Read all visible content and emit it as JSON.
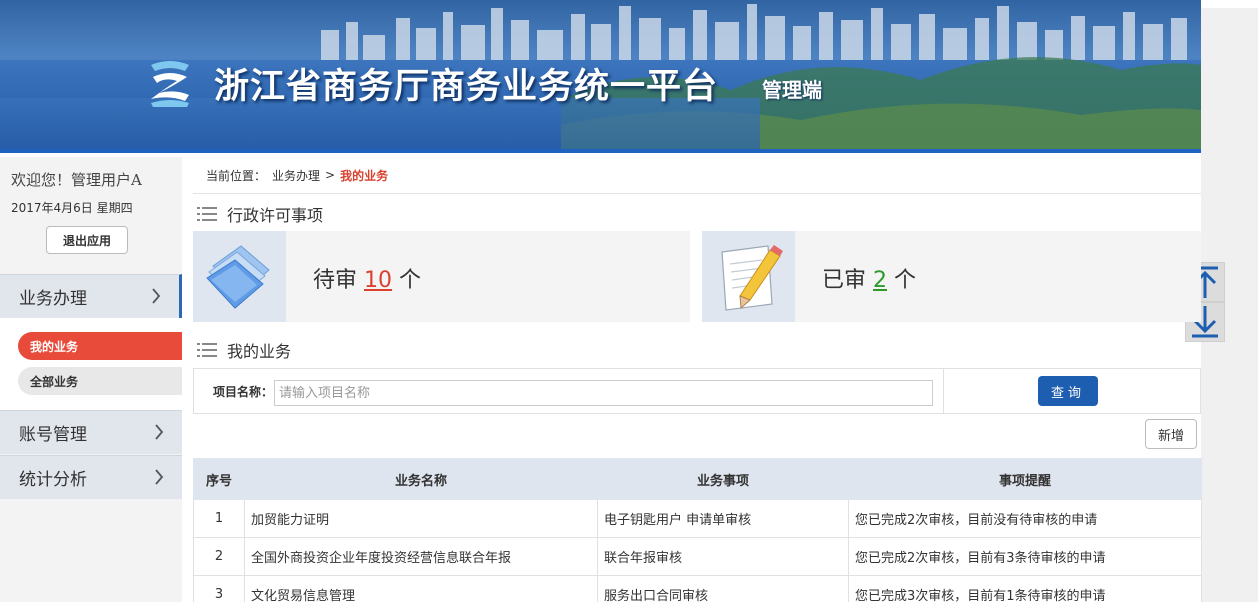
{
  "banner": {
    "title": "浙江省商务厅商务业务统一平台",
    "subtitle": "管理端"
  },
  "sidebar": {
    "welcome": "欢迎您！管理用户A",
    "date": "2017年4月6日 星期四",
    "logout_label": "退出应用",
    "menu": [
      {
        "label": "业务办理",
        "active": true
      },
      {
        "label": "账号管理",
        "active": false
      },
      {
        "label": "统计分析",
        "active": false
      }
    ],
    "submenu": [
      {
        "label": "我的业务",
        "active": true
      },
      {
        "label": "全部业务",
        "active": false
      }
    ]
  },
  "breadcrumb": {
    "prefix": "当前位置：",
    "parent": "业务办理",
    "sep": ">",
    "current": "我的业务"
  },
  "section_permits": {
    "title": "行政许可事项"
  },
  "stats": {
    "pending": {
      "label": "待审",
      "count": "10",
      "unit": "个"
    },
    "done": {
      "label": "已审",
      "count": "2",
      "unit": "个"
    }
  },
  "section_mybiz": {
    "title": "我的业务"
  },
  "search": {
    "label": "项目名称：",
    "placeholder": "请输入项目名称",
    "query_label": "查询",
    "add_label": "新增"
  },
  "table": {
    "headers": [
      "序号",
      "业务名称",
      "业务事项",
      "事项提醒"
    ],
    "rows": [
      {
        "no": "1",
        "name": "加贸能力证明",
        "item": "电子钥匙用户 申请单审核",
        "reminder": "您已完成2次审核，目前没有待审核的申请"
      },
      {
        "no": "2",
        "name": "全国外商投资企业年度投资经营信息联合年报",
        "item": "联合年报审核",
        "reminder": "您已完成2次审核，目前有3条待审核的申请"
      },
      {
        "no": "3",
        "name": "文化贸易信息管理",
        "item": "服务出口合同审核",
        "reminder": "您已完成3次审核，目前有1条待审核的申请"
      }
    ]
  },
  "colors": {
    "accent_blue": "#1d5eb1",
    "active_red": "#e94b3b",
    "pending_red": "#d9412e",
    "done_green": "#2b9a2b"
  },
  "icons": [
    "logo-icon",
    "list-icon",
    "folder-icon",
    "document-pencil-icon",
    "chevron-right-icon",
    "arrow-up-icon",
    "arrow-down-icon"
  ]
}
